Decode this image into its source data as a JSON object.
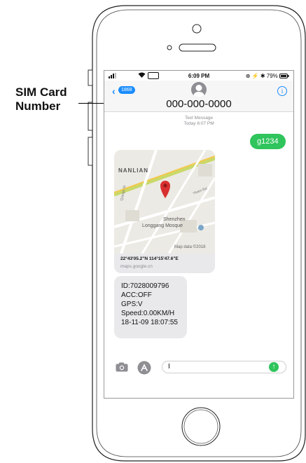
{
  "callout": {
    "line1": "SIM Card",
    "line2": "Number"
  },
  "status_bar": {
    "signal": ".ııl",
    "time": "6:09 PM",
    "battery": "79%"
  },
  "nav": {
    "back_count": "1868",
    "contact_number": "000-000-0000",
    "info_glyph": "i"
  },
  "thread": {
    "meta_label": "Text Message",
    "meta_time": "Today 6:07 PM",
    "outgoing": "g1234",
    "map": {
      "label_nanlian": "NANLIAN",
      "road_1": "Yiwen Rd",
      "road_2": "Qiaogu St",
      "place_name_1": "Shenzhen",
      "place_name_2": "Longgang Mosque",
      "map_credit": "Map data ©2018",
      "coords": "22°43'05.2\"N 114°15'47.6\"E",
      "domain": "maps.google.cn"
    },
    "incoming_lines": [
      "ID:7028009796",
      "ACC:OFF",
      "GPS:V",
      "Speed:0.00KM/H",
      "18-11-09 18:07:55"
    ]
  },
  "composer": {
    "input_value": "I",
    "send_glyph": "↑"
  },
  "colors": {
    "accent_blue": "#1a8cff",
    "imessage_green": "#2fc45c",
    "bubble_gray": "#e9e9ec"
  },
  "icons": [
    "signal-icon",
    "wifi-icon",
    "bluetooth-icon",
    "battery-icon",
    "back-chevron-icon",
    "avatar-icon",
    "info-icon",
    "map-pin-icon",
    "camera-icon",
    "app-store-icon",
    "send-icon"
  ]
}
